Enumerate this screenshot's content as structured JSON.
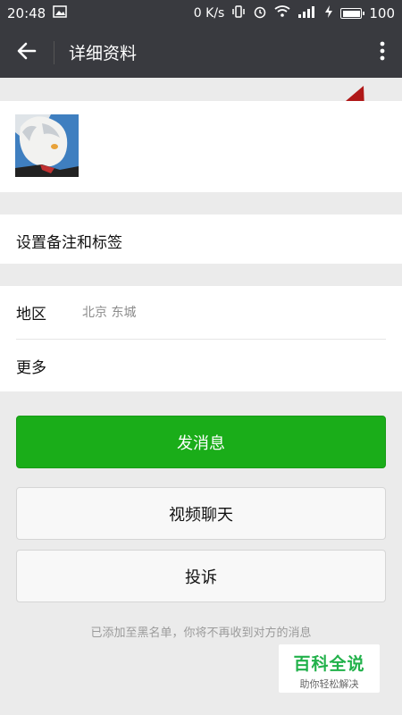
{
  "status_bar": {
    "time": "20:48",
    "speed": "0 K/s",
    "battery": "100"
  },
  "header": {
    "title": "详细资料",
    "back_icon": "arrow-left-icon",
    "more_icon": "more-vertical-icon"
  },
  "profile": {
    "avatar": "anime-avatar"
  },
  "remark": {
    "label": "设置备注和标签"
  },
  "info": {
    "region_label": "地区",
    "region_value": "北京  东城",
    "more_label": "更多"
  },
  "actions": {
    "send_message": "发消息",
    "video_chat": "视频聊天",
    "report": "投诉"
  },
  "notice": "已添加至黑名单，你将不再收到对方的消息",
  "watermark": {
    "main": "百科全说",
    "sub": "助你轻松解决"
  },
  "colors": {
    "header_bg": "#393a3f",
    "primary_green": "#1aad19",
    "page_bg": "#ebebeb",
    "annotation_red": "#b01818"
  }
}
